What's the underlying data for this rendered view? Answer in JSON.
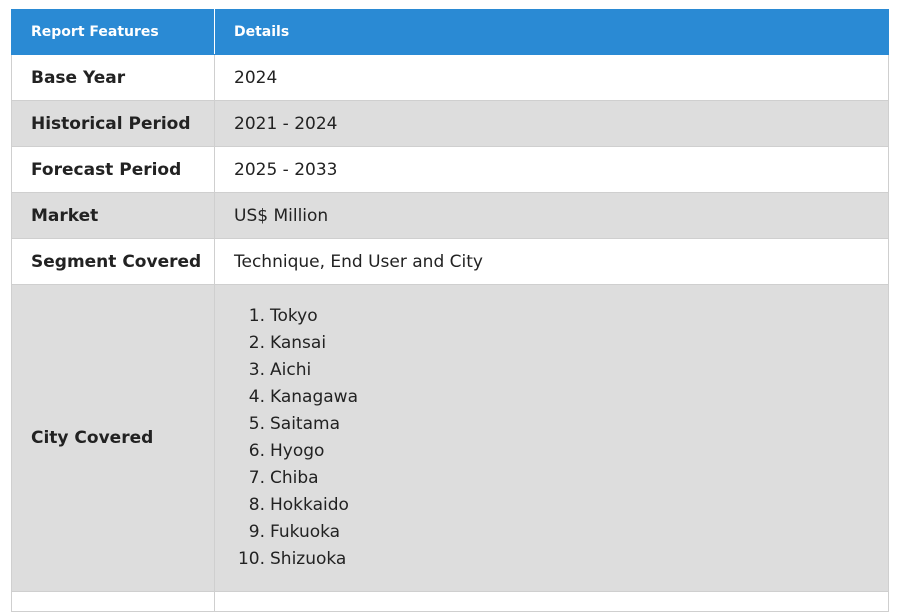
{
  "table": {
    "header": {
      "feature_label": "Report Features",
      "details_label": "Details"
    },
    "rows": [
      {
        "feature": "Base Year",
        "details": "2024"
      },
      {
        "feature": "Historical Period",
        "details": "2021 - 2024"
      },
      {
        "feature": "Forecast Period",
        "details": "2025 - 2033"
      },
      {
        "feature": "Market",
        "details": "US$ Million"
      },
      {
        "feature": "Segment Covered",
        "details": "Technique, End User and City"
      }
    ],
    "city_row": {
      "feature": "City Covered",
      "cities": [
        "Tokyo",
        "Kansai",
        "Aichi",
        "Kanagawa",
        "Saitama",
        "Hyogo",
        "Chiba",
        "Hokkaido",
        "Fukuoka",
        "Shizuoka"
      ]
    }
  },
  "colors": {
    "header_bg": "#2a8ad4",
    "row_alt_bg": "#dddddd",
    "row_bg": "#ffffff"
  }
}
